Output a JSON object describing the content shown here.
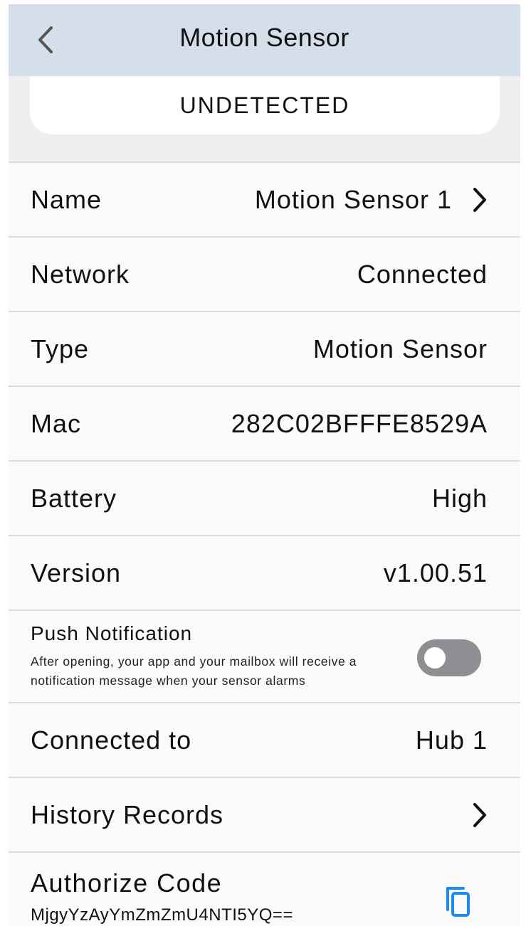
{
  "header": {
    "title": "Motion Sensor",
    "back_icon": "chevron-left-icon"
  },
  "status": {
    "label": "UNDETECTED"
  },
  "rows": {
    "name": {
      "label": "Name",
      "value": "Motion Sensor 1"
    },
    "network": {
      "label": "Network",
      "value": "Connected"
    },
    "type": {
      "label": "Type",
      "value": "Motion Sensor"
    },
    "mac": {
      "label": "Mac",
      "value": "282C02BFFFE8529A"
    },
    "battery": {
      "label": "Battery",
      "value": "High"
    },
    "version": {
      "label": "Version",
      "value": "v1.00.51"
    },
    "push": {
      "title": "Push Notification",
      "description": "After opening, your app  and your mailbox will receive a notification message when your sensor alarms",
      "enabled": false
    },
    "connected_to": {
      "label": "Connected to",
      "value": "Hub 1"
    },
    "history": {
      "label": "History Records"
    },
    "authorize": {
      "label": "Authorize Code",
      "code": "MjgyYzAyYmZmZmU4NTI5YQ=="
    }
  },
  "colors": {
    "navbar": "#d5dfec",
    "accent_blue": "#1a8cf0",
    "toggle_off": "#8e8e93"
  }
}
